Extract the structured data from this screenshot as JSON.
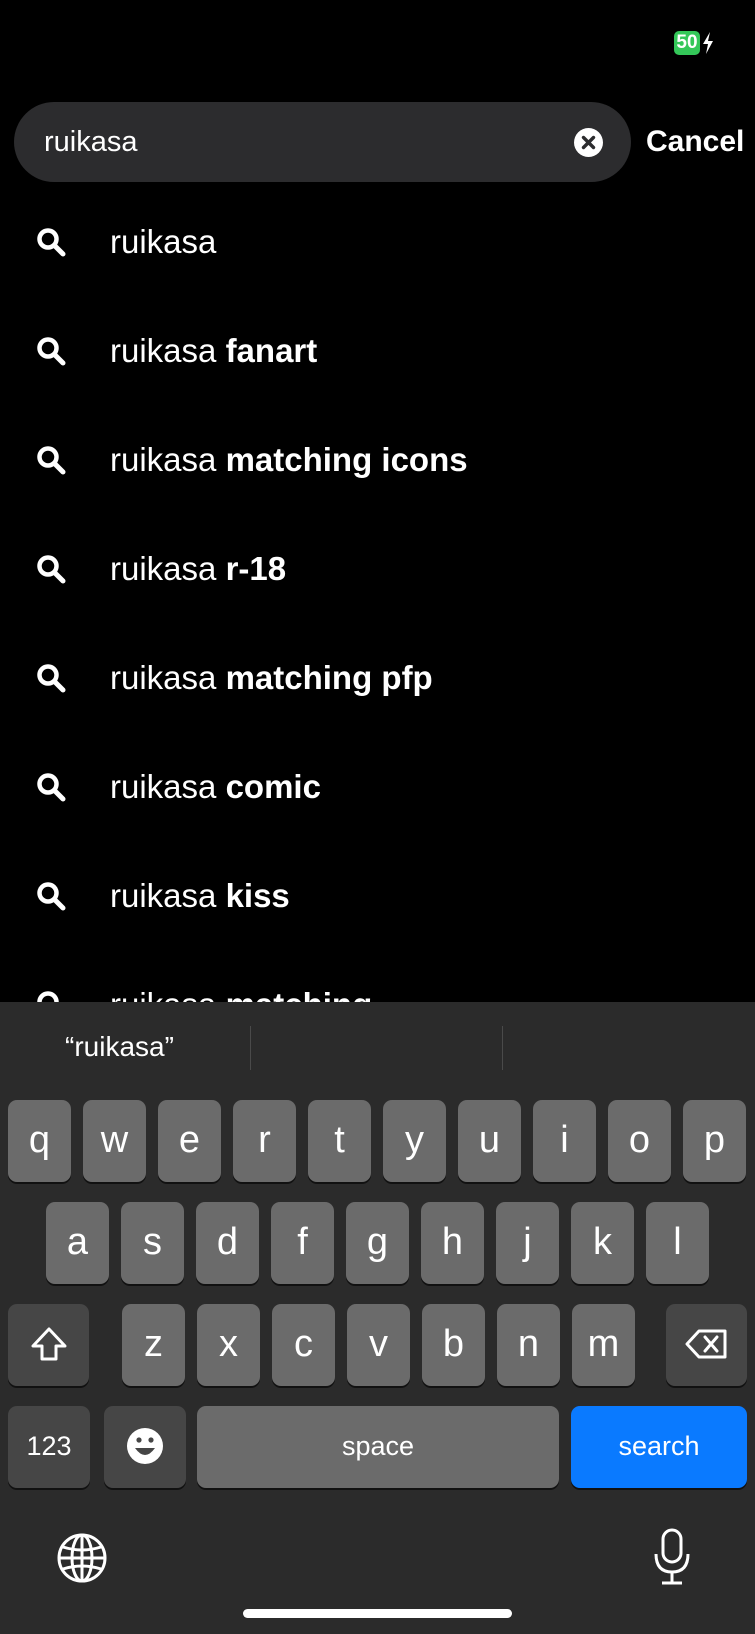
{
  "status_bar": {
    "battery_level": "50"
  },
  "search": {
    "query": "ruikasa",
    "cancel_label": "Cancel"
  },
  "suggestions": [
    {
      "prefix": "ruikasa",
      "suffix": ""
    },
    {
      "prefix": "ruikasa",
      "suffix": "fanart"
    },
    {
      "prefix": "ruikasa",
      "suffix": "matching icons"
    },
    {
      "prefix": "ruikasa",
      "suffix": "r-18"
    },
    {
      "prefix": "ruikasa",
      "suffix": "matching pfp"
    },
    {
      "prefix": "ruikasa",
      "suffix": "comic"
    },
    {
      "prefix": "ruikasa",
      "suffix": "kiss"
    },
    {
      "prefix": "ruikasa",
      "suffix": "matching"
    }
  ],
  "keyboard": {
    "prediction": "“ruikasa”",
    "row1": [
      "q",
      "w",
      "e",
      "r",
      "t",
      "y",
      "u",
      "i",
      "o",
      "p"
    ],
    "row2": [
      "a",
      "s",
      "d",
      "f",
      "g",
      "h",
      "j",
      "k",
      "l"
    ],
    "row3": [
      "z",
      "x",
      "c",
      "v",
      "b",
      "n",
      "m"
    ],
    "numbers_label": "123",
    "space_label": "space",
    "search_label": "search",
    "accent_color": "#0a7aff"
  }
}
